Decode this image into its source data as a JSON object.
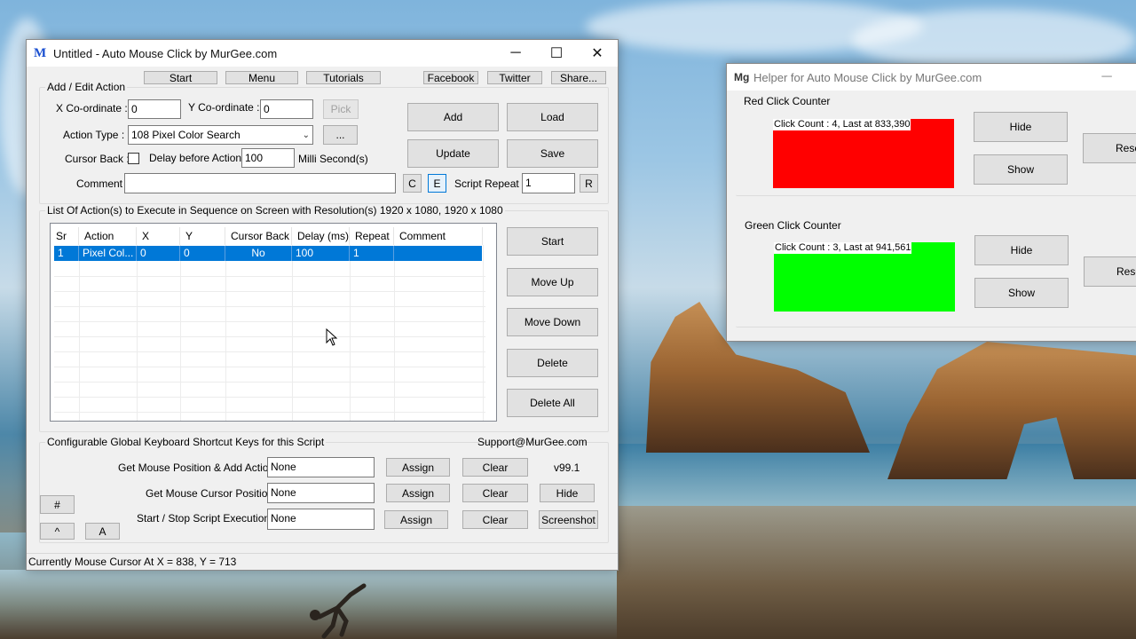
{
  "main_window": {
    "title": "Untitled - Auto Mouse Click by MurGee.com",
    "logo": "M",
    "controls": {
      "minimize": "─",
      "maximize": "☐",
      "close": "✕"
    },
    "toolbar": {
      "start": "Start",
      "menu": "Menu",
      "tutorials": "Tutorials",
      "facebook": "Facebook",
      "twitter": "Twitter",
      "share": "Share..."
    },
    "add_edit": {
      "group_title": "Add / Edit Action",
      "x_label": "X Co-ordinate :",
      "x_value": "0",
      "y_label": "Y Co-ordinate :",
      "y_value": "0",
      "pick": "Pick",
      "action_type_label": "Action Type :",
      "action_type_value": "108 Pixel Color Search",
      "ellipsis": "...",
      "cursor_back_label": "Cursor Back :",
      "delay_label": "Delay before Action :",
      "delay_value": "100",
      "delay_unit": "Milli Second(s)",
      "comment_label": "Comment :",
      "comment_value": "",
      "c_button": "C",
      "e_button": "E",
      "script_repeat_label": "Script Repeat :",
      "script_repeat_value": "1",
      "r_button": "R",
      "add": "Add",
      "load": "Load",
      "update": "Update",
      "save": "Save"
    },
    "list": {
      "group_title": "List Of Action(s) to Execute in Sequence on Screen with Resolution(s) 1920 x 1080, 1920 x 1080",
      "columns": [
        "Sr",
        "Action",
        "X",
        "Y",
        "Cursor Back",
        "Delay (ms)",
        "Repeat",
        "Comment"
      ],
      "rows": [
        {
          "sr": "1",
          "action": "Pixel Col...",
          "x": "0",
          "y": "0",
          "cursor_back": "No",
          "delay": "100",
          "repeat": "1",
          "comment": ""
        }
      ],
      "buttons": {
        "start": "Start",
        "move_up": "Move Up",
        "move_down": "Move Down",
        "delete": "Delete",
        "delete_all": "Delete All"
      }
    },
    "shortcuts": {
      "group_title": "Configurable Global Keyboard Shortcut Keys for this Script",
      "support": "Support@MurGee.com",
      "version": "v99.1",
      "rows": [
        {
          "label": "Get Mouse Position & Add Action :",
          "value": "None",
          "assign": "Assign",
          "clear": "Clear"
        },
        {
          "label": "Get Mouse Cursor Position :",
          "value": "None",
          "assign": "Assign",
          "clear": "Clear"
        },
        {
          "label": "Start / Stop Script Execution :",
          "value": "None",
          "assign": "Assign",
          "clear": "Clear"
        }
      ],
      "hide": "Hide",
      "screenshot": "Screenshot",
      "hash": "#",
      "caret": "^",
      "a": "A"
    },
    "status": "Currently Mouse Cursor At X = 838, Y = 713"
  },
  "helper_window": {
    "logo": "Mg",
    "title": "Helper for Auto Mouse Click by MurGee.com",
    "minimize": "─",
    "red": {
      "title": "Red Click Counter",
      "label": "Click Count : 4, Last at 833,390",
      "color": "#ff0000",
      "hide": "Hide",
      "show": "Show",
      "reset": "Rese"
    },
    "green": {
      "title": "Green Click Counter",
      "label": "Click Count : 3, Last at 941,561",
      "color": "#00ff00",
      "hide": "Hide",
      "show": "Show",
      "reset": "Rese"
    }
  }
}
